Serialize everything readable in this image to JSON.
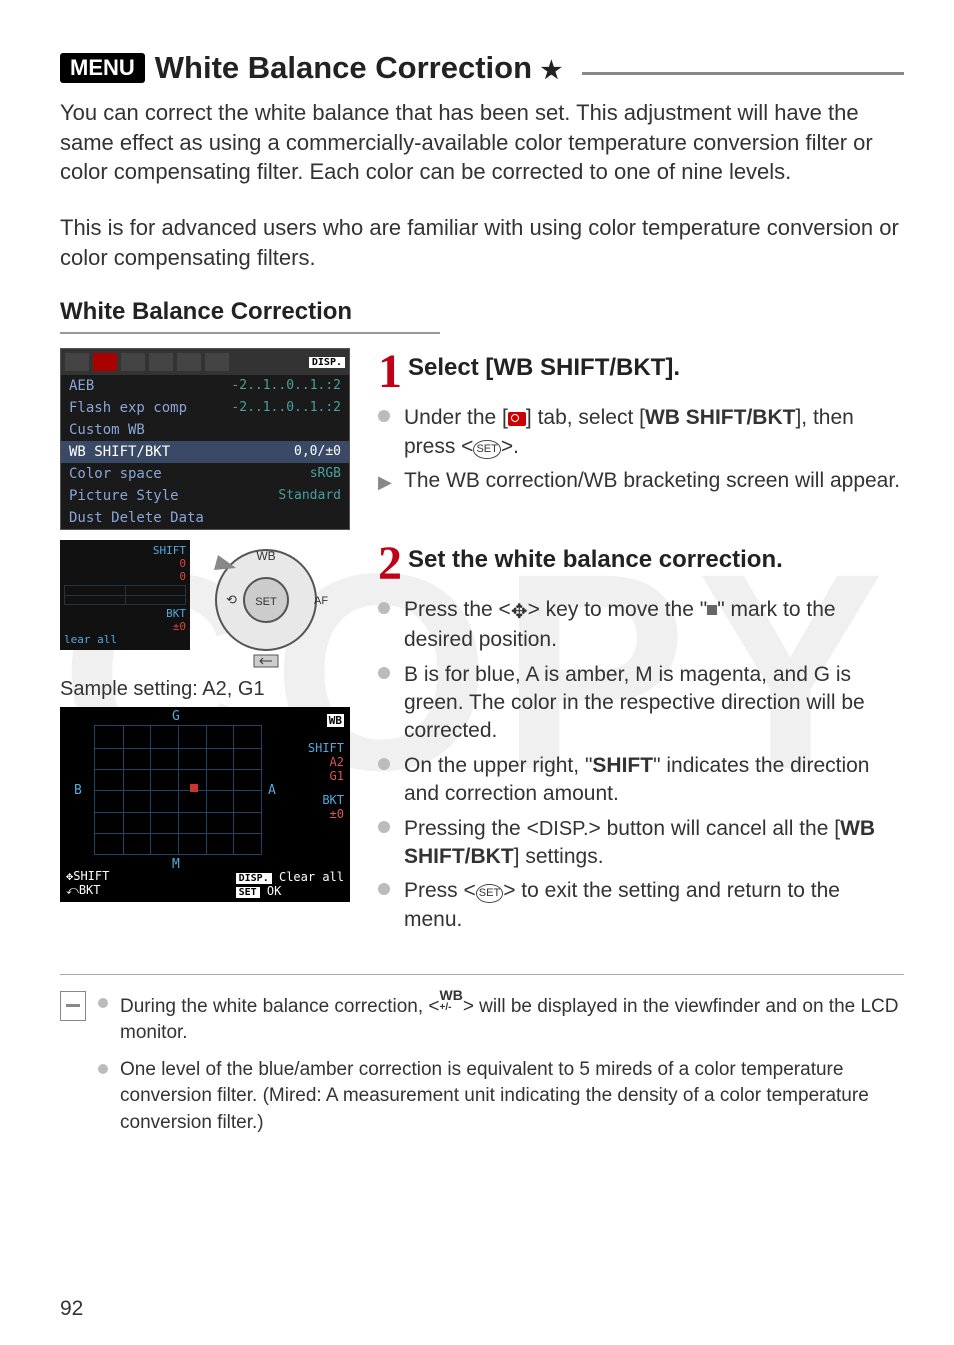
{
  "page_number": "92",
  "title": {
    "menu_badge": "MENU",
    "text": "White Balance Correction",
    "star": "★"
  },
  "intro": {
    "p1": "You can correct the white balance that has been set. This adjustment will have the same effect as using a commercially-available color temperature conversion filter or color compensating filter. Each color can be corrected to one of nine levels.",
    "p2": "This is for advanced users who are familiar with using color temperature conversion or color compensating filters."
  },
  "section_heading": "White Balance Correction",
  "cam_menu": {
    "disp": "DISP.",
    "rows": [
      {
        "label": "AEB",
        "val": "-2..1..0..1.:2"
      },
      {
        "label": "Flash exp comp",
        "val": "-2..1..0..1.:2"
      },
      {
        "label": "Custom WB",
        "val": ""
      },
      {
        "label": "WB SHIFT/BKT",
        "val": "0,0/±0",
        "sel": true
      },
      {
        "label": "Color space",
        "val": "sRGB"
      },
      {
        "label": "Picture Style",
        "val": "Standard"
      },
      {
        "label": "Dust Delete Data",
        "val": ""
      }
    ]
  },
  "small_screen": {
    "shift": "SHIFT",
    "bkt": "BKT",
    "clear": "lear all",
    "wb": "WB"
  },
  "sample_label": "Sample setting: A2, G1",
  "wb_screen": {
    "g": "G",
    "b": "B",
    "a": "A",
    "m": "M",
    "wb_icon": "WB",
    "shift": "SHIFT",
    "a2": "A2",
    "g1": "G1",
    "bkt": "BKT",
    "pm0": "±0",
    "shift_lbl": "SHIFT",
    "bkt_lbl": "BKT",
    "disp": "DISP.",
    "clear": "Clear all",
    "set": "SET",
    "ok": "OK"
  },
  "step1": {
    "num": "1",
    "title": "Select [WB SHIFT/BKT].",
    "b1a": "Under the [",
    "b1b": "] tab, select [",
    "b1bold": "WB SHIFT/BKT",
    "b1c": "], then press <",
    "set": "SET",
    "b1d": ">.",
    "b2": "The WB correction/WB bracketing screen will appear."
  },
  "step2": {
    "num": "2",
    "title": "Set the white balance correction.",
    "b1a": "Press the <",
    "b1b": "> key to move the \"",
    "b1c": "\" mark to the desired position.",
    "b2": "B is for blue, A is amber, M is magenta, and G is green. The color in the respective direction will be corrected.",
    "b3a": "On the upper right, \"",
    "b3bold": "SHIFT",
    "b3b": "\" indicates the direction and correction amount.",
    "b4a": "Pressing the <",
    "b4disp": "DISP.",
    "b4b": "> button will cancel all the [",
    "b4bold": "WB SHIFT/BKT",
    "b4c": "] settings.",
    "b5a": "Press <",
    "set": "SET",
    "b5b": "> to exit the setting and return to the menu."
  },
  "notes": {
    "n1a": "During the white balance correction, <",
    "n1sym": "WB +/-",
    "n1b": "> will be displayed in the viewfinder and on the LCD monitor.",
    "n2": "One level of the blue/amber correction is equivalent to 5 mireds of a color temperature conversion filter. (Mired: A measurement unit indicating the density of a color temperature conversion filter.)"
  }
}
